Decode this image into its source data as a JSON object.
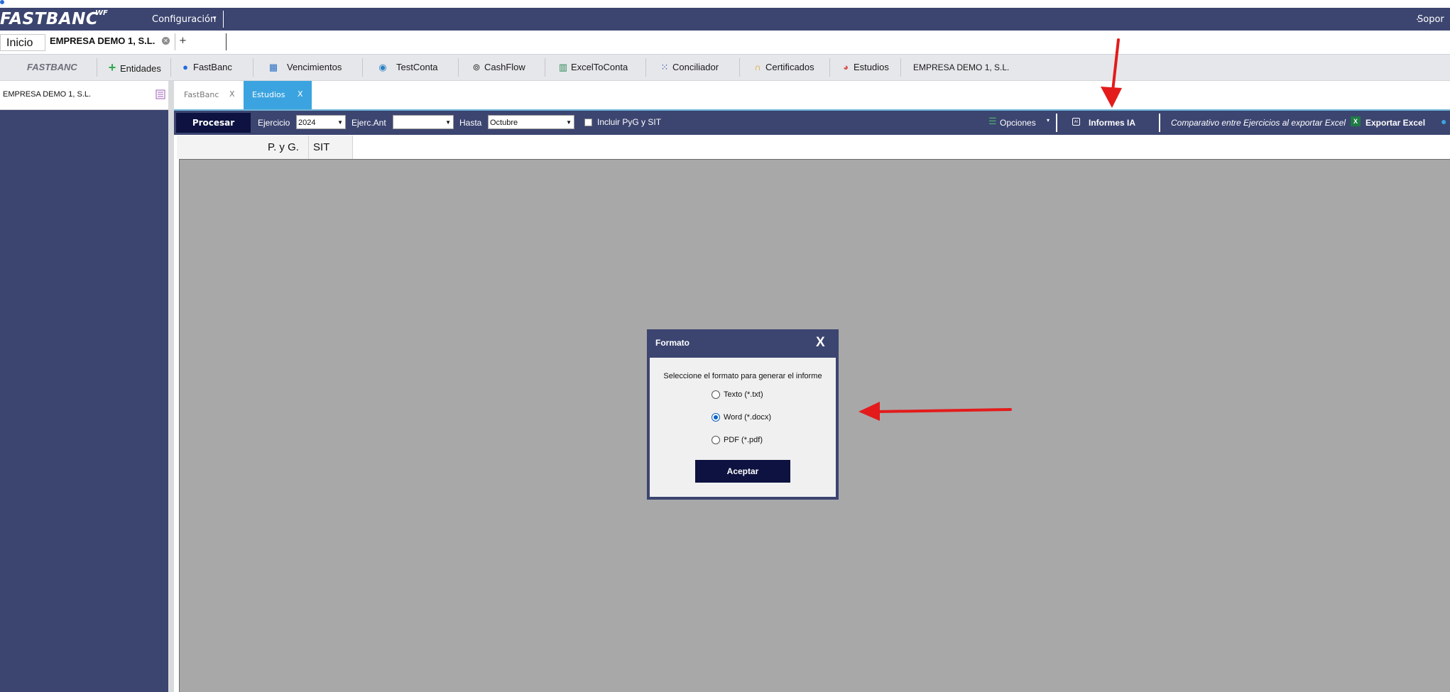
{
  "header": {
    "brand": "FASTBANC",
    "brand_suffix": "WF",
    "config_menu": "Configuración",
    "support": "Sopor",
    "colors": {
      "bar": "#3c4570",
      "accent": "#3ba4e0",
      "button": "#0d1240"
    }
  },
  "doc_tabs": {
    "home": "Inicio",
    "company_tab": "EMPRESA DEMO 1, S.L.",
    "add": "+"
  },
  "modules": [
    {
      "label": "FASTBANC",
      "icon": "fastbanc-logo"
    },
    {
      "label": "Entidades",
      "icon": "plus-icon"
    },
    {
      "label": "FastBanc",
      "icon": "apple-icon"
    },
    {
      "label": "Vencimientos",
      "icon": "calendar-icon"
    },
    {
      "label": "TestConta",
      "icon": "globe-icon"
    },
    {
      "label": "CashFlow",
      "icon": "coin-icon"
    },
    {
      "label": "ExcelToConta",
      "icon": "bars-icon"
    },
    {
      "label": "Conciliador",
      "icon": "grid-icon"
    },
    {
      "label": "Certificados",
      "icon": "headset-icon"
    },
    {
      "label": "Estudios",
      "icon": "chart-icon"
    },
    {
      "label": "EMPRESA DEMO 1, S.L.",
      "icon": ""
    }
  ],
  "sidebar": {
    "title": "EMPRESA DEMO 1, S.L."
  },
  "subtabs": [
    {
      "label": "FastBanc",
      "close": "X",
      "active": false
    },
    {
      "label": "Estudios",
      "close": "X",
      "active": true
    }
  ],
  "toolbar": {
    "process_button": "Procesar",
    "ejercicio_label": "Ejercicio",
    "ejercicio_value": "2024",
    "ejerc_ant_label": "Ejerc.Ant",
    "ejerc_ant_value": "",
    "hasta_label": "Hasta",
    "hasta_value": "Octubre",
    "include_pyg_sit": "Incluir PyG y SIT",
    "options": "Opciones",
    "ia_icon_text": "AI",
    "informes_ia": "Informes IA",
    "comparativo": "Comparativo entre Ejercicios al exportar Excel",
    "export_excel": "Exportar Excel"
  },
  "sheet_tabs": [
    "P. y G.",
    "SIT"
  ],
  "dialog": {
    "title": "Formato",
    "close": "X",
    "prompt": "Seleccione el formato para generar el informe",
    "options": [
      {
        "label": "Texto (*.txt)",
        "selected": false
      },
      {
        "label": "Word (*.docx)",
        "selected": true
      },
      {
        "label": "PDF (*.pdf)",
        "selected": false
      }
    ],
    "accept": "Aceptar"
  }
}
